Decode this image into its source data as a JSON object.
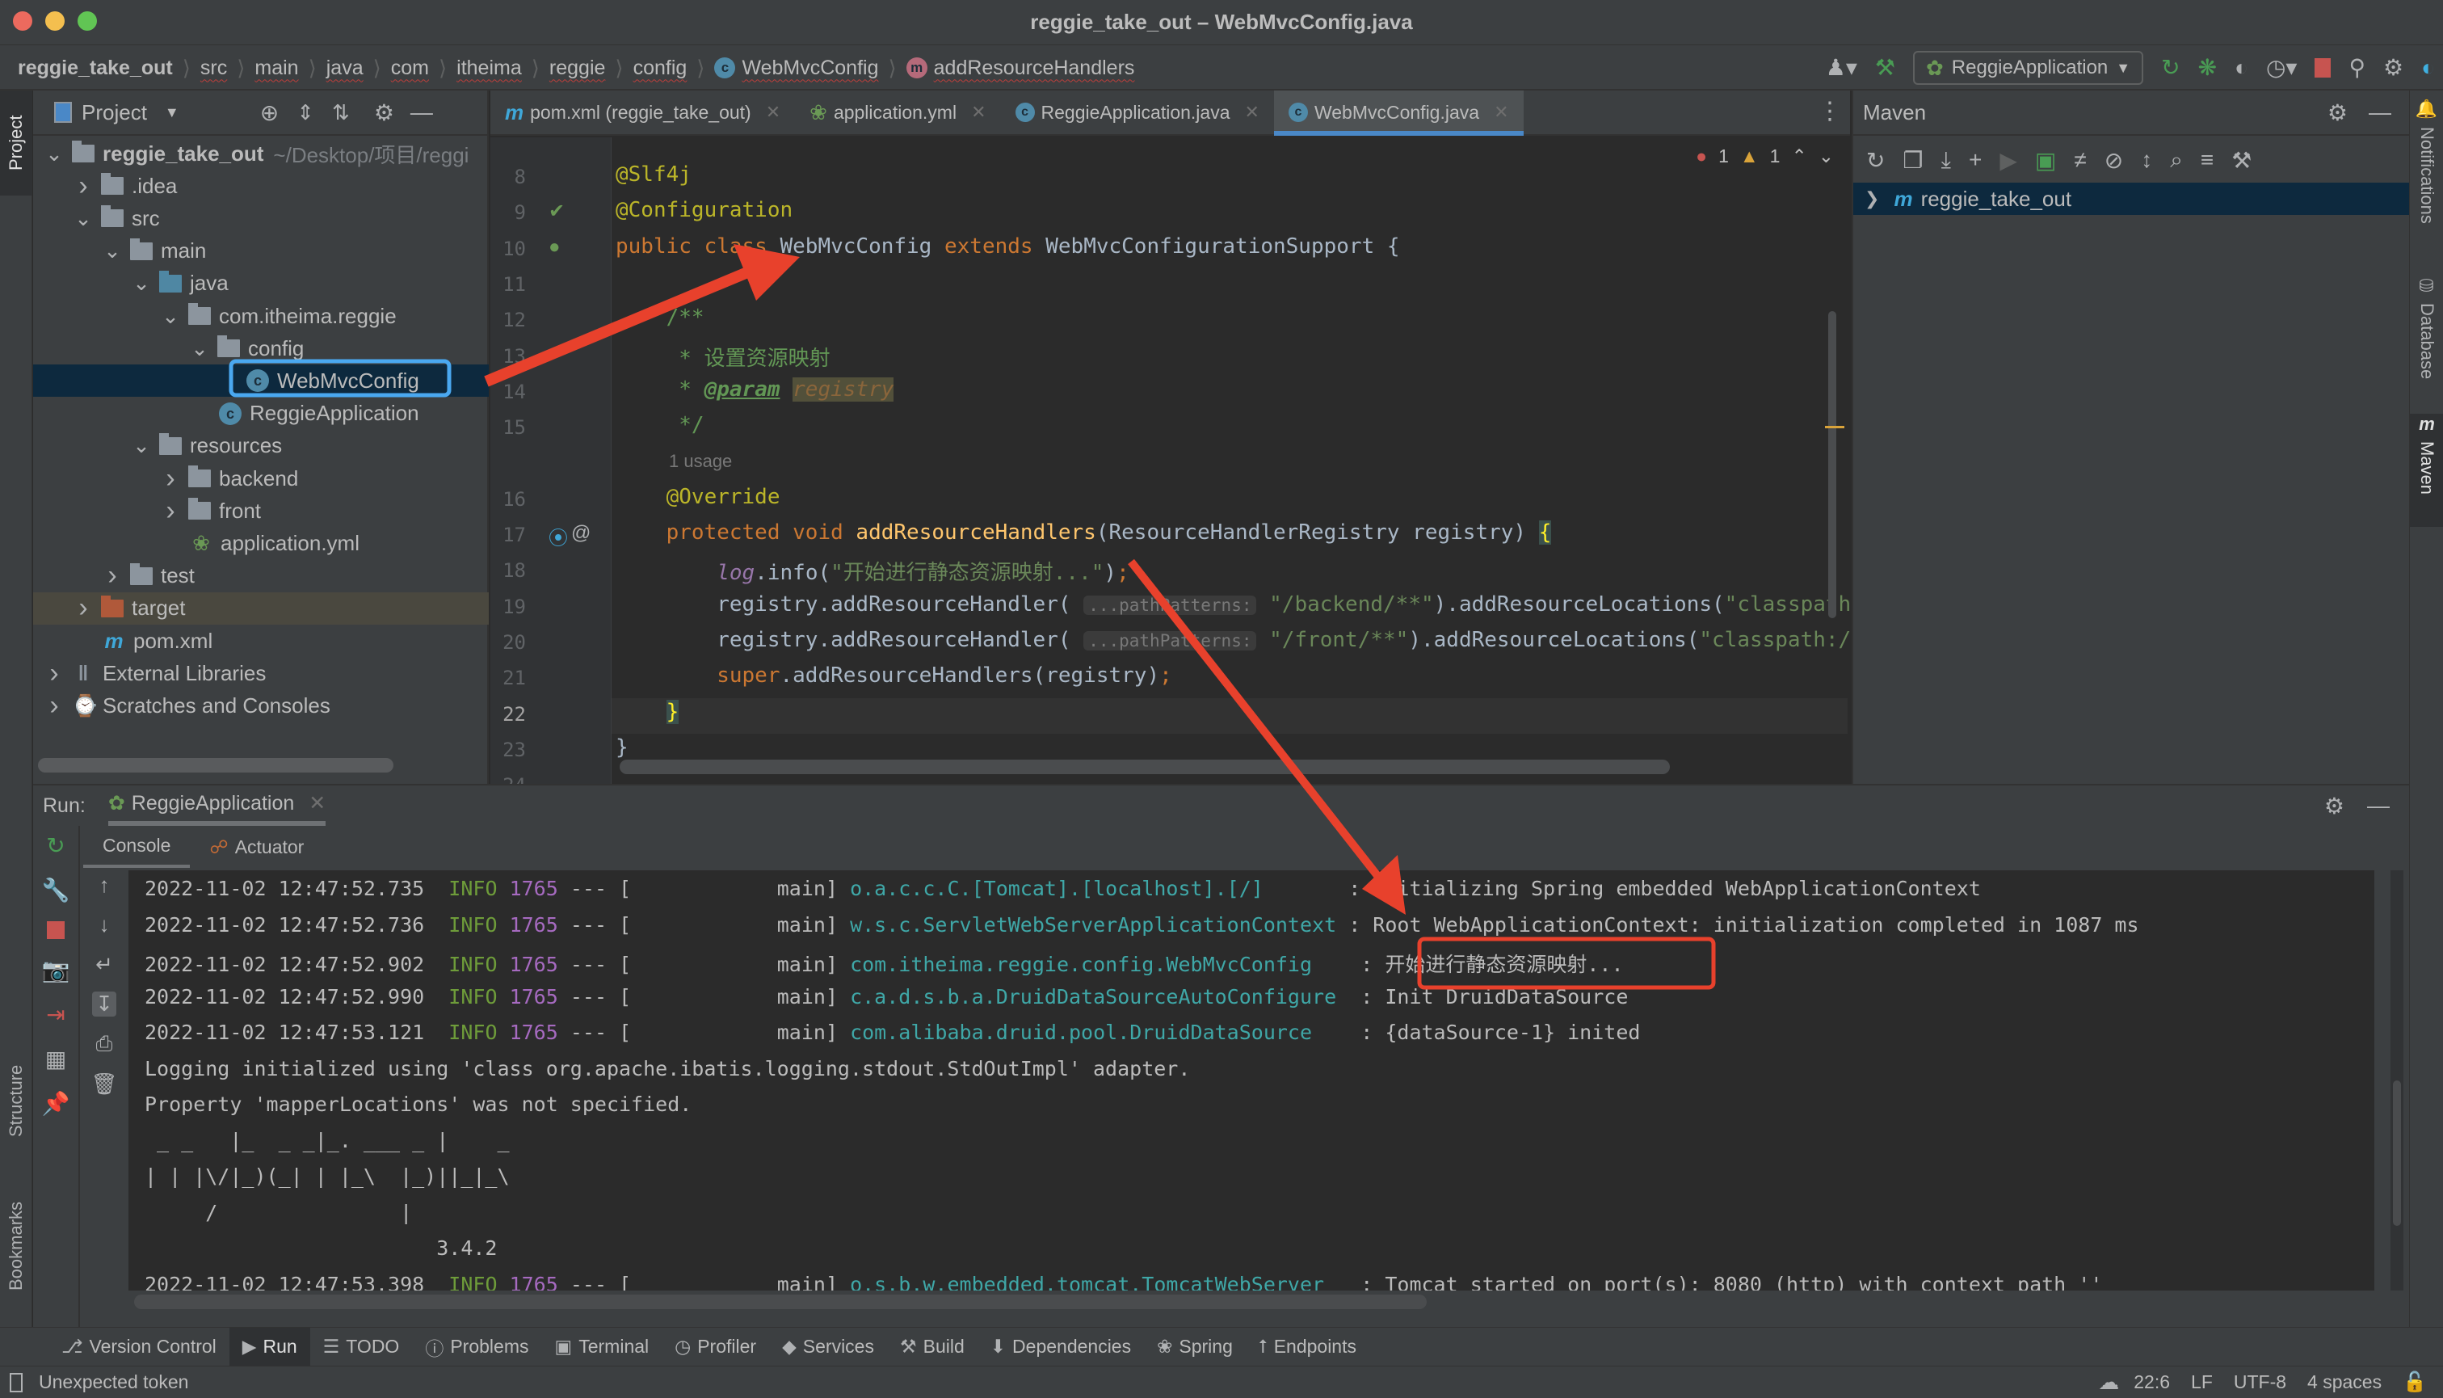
{
  "window": {
    "title": "reggie_take_out – WebMvcConfig.java"
  },
  "breadcrumb": [
    {
      "label": "reggie_take_out"
    },
    {
      "label": "src"
    },
    {
      "label": "main"
    },
    {
      "label": "java"
    },
    {
      "label": "com"
    },
    {
      "label": "itheima"
    },
    {
      "label": "reggie"
    },
    {
      "label": "config"
    },
    {
      "label": "WebMvcConfig",
      "icon": "class-icon"
    },
    {
      "label": "addResourceHandlers",
      "icon": "method-icon"
    }
  ],
  "toolbar": {
    "run_config": "ReggieApplication",
    "icons": [
      "user-icon",
      "build-hammer-icon",
      "rerun-icon",
      "debug-icon",
      "coverage-icon",
      "profile-icon",
      "stop-icon",
      "search-icon",
      "settings-icon",
      "toolbox-icon"
    ]
  },
  "project": {
    "title": "Project",
    "tree": [
      {
        "label": "reggie_take_out",
        "hint": "~/Desktop/项目/reggi",
        "depth": 0,
        "chevron": "down",
        "icon": "module-folder-icon",
        "bold": true
      },
      {
        "label": ".idea",
        "depth": 1,
        "chevron": "right",
        "icon": "folder-icon"
      },
      {
        "label": "src",
        "depth": 1,
        "chevron": "down",
        "icon": "folder-icon"
      },
      {
        "label": "main",
        "depth": 2,
        "chevron": "down",
        "icon": "folder-icon"
      },
      {
        "label": "java",
        "depth": 3,
        "chevron": "down",
        "icon": "source-folder-icon"
      },
      {
        "label": "com.itheima.reggie",
        "depth": 4,
        "chevron": "down",
        "icon": "package-icon"
      },
      {
        "label": "config",
        "depth": 5,
        "chevron": "down",
        "icon": "package-icon"
      },
      {
        "label": "WebMvcConfig",
        "depth": 6,
        "chevron": "",
        "icon": "class-icon",
        "selected": true
      },
      {
        "label": "ReggieApplication",
        "depth": 5.5,
        "chevron": "",
        "icon": "spring-boot-class-icon"
      },
      {
        "label": "resources",
        "depth": 3,
        "chevron": "down",
        "icon": "resources-folder-icon"
      },
      {
        "label": "backend",
        "depth": 4,
        "chevron": "right",
        "icon": "folder-icon"
      },
      {
        "label": "front",
        "depth": 4,
        "chevron": "right",
        "icon": "folder-icon"
      },
      {
        "label": "application.yml",
        "depth": 4.5,
        "chevron": "",
        "icon": "spring-yml-icon"
      },
      {
        "label": "test",
        "depth": 2,
        "chevron": "right",
        "icon": "folder-icon"
      },
      {
        "label": "target",
        "depth": 1,
        "chevron": "right",
        "icon": "excluded-folder-icon",
        "excluded": true
      },
      {
        "label": "pom.xml",
        "depth": 1.5,
        "chevron": "",
        "icon": "maven-icon"
      },
      {
        "label": "External Libraries",
        "depth": 0,
        "chevron": "right",
        "icon": "libraries-icon"
      },
      {
        "label": "Scratches and Consoles",
        "depth": 0,
        "chevron": "right",
        "icon": "scratches-icon"
      }
    ]
  },
  "editor": {
    "tabs": [
      {
        "label": "pom.xml (reggie_take_out)",
        "icon": "maven-icon"
      },
      {
        "label": "application.yml",
        "icon": "spring-yml-icon"
      },
      {
        "label": "ReggieApplication.java",
        "icon": "spring-boot-class-icon"
      },
      {
        "label": "WebMvcConfig.java",
        "icon": "class-icon",
        "active": true
      }
    ],
    "inspections": {
      "errors": "1",
      "warnings": "1"
    },
    "lines": [
      {
        "n": "8",
        "parts": [
          [
            "ann",
            "@Slf4j"
          ]
        ]
      },
      {
        "n": "9",
        "parts": [
          [
            "ann",
            "@Configuration"
          ]
        ]
      },
      {
        "n": "10",
        "parts": [
          [
            "kw",
            "public class "
          ],
          [
            "",
            "WebMvcConfig "
          ],
          [
            "kw",
            "extends "
          ],
          [
            "",
            "WebMvcConfigurationSupport {"
          ]
        ]
      },
      {
        "n": "11",
        "parts": []
      },
      {
        "n": "12",
        "parts": [
          [
            "cm",
            "    /**"
          ]
        ]
      },
      {
        "n": "13",
        "parts": [
          [
            "cm",
            "     * 设置资源映射"
          ]
        ]
      },
      {
        "n": "14",
        "parts": [
          [
            "cm",
            "     * "
          ],
          [
            "cmtag",
            "@param"
          ],
          [
            "cm",
            " "
          ],
          [
            "cmparam",
            "registry"
          ]
        ]
      },
      {
        "n": "15",
        "parts": [
          [
            "cm",
            "     */"
          ]
        ]
      },
      {
        "n": "",
        "usage": "1 usage"
      },
      {
        "n": "16",
        "parts": [
          [
            "ann",
            "    @Override"
          ]
        ]
      },
      {
        "n": "17",
        "parts": [
          [
            "kw",
            "    protected void "
          ],
          [
            "fn",
            "addResourceHandlers"
          ],
          [
            "",
            "(ResourceHandlerRegistry registry) "
          ],
          [
            "brace",
            "{"
          ]
        ]
      },
      {
        "n": "18",
        "parts": [
          [
            "",
            "        "
          ],
          [
            "lg",
            "log"
          ],
          [
            "",
            ".info("
          ],
          [
            "str",
            "\"开始进行静态资源映射...\""
          ],
          [
            "",
            ")"
          ],
          [
            "kw",
            ";"
          ]
        ]
      },
      {
        "n": "19",
        "parts": [
          [
            "",
            "        registry.addResourceHandler( "
          ],
          [
            "hint",
            "...pathPatterns:"
          ],
          [
            "",
            " "
          ],
          [
            "str",
            "\"/backend/**\""
          ],
          [
            "",
            ").addResourceLocations("
          ],
          [
            "str",
            "\"classpath:/backend/\""
          ],
          [
            "",
            ");"
          ]
        ]
      },
      {
        "n": "20",
        "parts": [
          [
            "",
            "        registry.addResourceHandler( "
          ],
          [
            "hint",
            "...pathPatterns:"
          ],
          [
            "",
            " "
          ],
          [
            "str",
            "\"/front/**\""
          ],
          [
            "",
            ").addResourceLocations("
          ],
          [
            "str",
            "\"classpath:/front/\""
          ],
          [
            "",
            ");"
          ]
        ]
      },
      {
        "n": "21",
        "parts": [
          [
            "kw",
            "        super"
          ],
          [
            "",
            ".addResourceHandlers(registry)"
          ],
          [
            "kw",
            ";"
          ]
        ]
      },
      {
        "n": "22",
        "parts": [
          [
            "",
            "    "
          ],
          [
            "brace",
            "}"
          ]
        ],
        "current": true
      },
      {
        "n": "23",
        "parts": [
          [
            "",
            "}"
          ]
        ]
      },
      {
        "n": "24",
        "parts": []
      }
    ]
  },
  "maven": {
    "title": "Maven",
    "tree": [
      {
        "label": "reggie_take_out"
      }
    ],
    "toolbar_icons": [
      "reload-icon",
      "add-maven-project-icon",
      "download-icon",
      "plus-icon",
      "run-maven-icon",
      "execute-goal-icon",
      "toggle-offline-icon",
      "skip-tests-icon",
      "collapse-icon",
      "analyze-dependencies-icon",
      "show-diagram-icon",
      "wrench-icon"
    ]
  },
  "right_stripe": [
    {
      "label": "Notifications",
      "icon": "bell-icon"
    },
    {
      "label": "Database",
      "icon": "database-icon"
    },
    {
      "label": "Maven",
      "icon": "maven-icon",
      "active": true
    }
  ],
  "left_stripe": [
    {
      "label": "Project",
      "active": true
    },
    {
      "label": "Structure"
    },
    {
      "label": "Bookmarks"
    }
  ],
  "run": {
    "label": "Run:",
    "config": "ReggieApplication",
    "tabs": [
      {
        "label": "Console",
        "active": true
      },
      {
        "label": "Actuator",
        "icon": "actuator-icon"
      }
    ],
    "log": [
      {
        "ts": "2022-11-02 12:47:52.735",
        "level": "INFO",
        "pid": "1765",
        "sep": "--- [",
        "thread": "           main]",
        "logger": "o.a.c.c.C.[Tomcat].[localhost].[/]      ",
        "msg": ": Initializing Spring embedded WebApplicationContext"
      },
      {
        "ts": "2022-11-02 12:47:52.736",
        "level": "INFO",
        "pid": "1765",
        "sep": "--- [",
        "thread": "           main]",
        "logger": "w.s.c.ServletWebServerApplicationContext",
        "msg": ": Root WebApplicationContext: initialization completed in 1087 ms"
      },
      {
        "ts": "2022-11-02 12:47:52.902",
        "level": "INFO",
        "pid": "1765",
        "sep": "--- [",
        "thread": "           main]",
        "logger": "com.itheima.reggie.config.WebMvcConfig   ",
        "msg": ": 开始进行静态资源映射...",
        "highlight": true
      },
      {
        "ts": "2022-11-02 12:47:52.990",
        "level": "INFO",
        "pid": "1765",
        "sep": "--- [",
        "thread": "           main]",
        "logger": "c.a.d.s.b.a.DruidDataSourceAutoConfigure ",
        "msg": ": Init DruidDataSource"
      },
      {
        "ts": "2022-11-02 12:47:53.121",
        "level": "INFO",
        "pid": "1765",
        "sep": "--- [",
        "thread": "           main]",
        "logger": "com.alibaba.druid.pool.DruidDataSource   ",
        "msg": ": {dataSource-1} inited"
      },
      {
        "plain": "Logging initialized using 'class org.apache.ibatis.logging.stdout.StdOutImpl' adapter."
      },
      {
        "plain": "Property 'mapperLocations' was not specified."
      },
      {
        "plain": " _ _   |_  _ _|_. ___ _ |    _ "
      },
      {
        "plain": "| | |\\/|_)(_| | |_\\  |_)||_|_\\ "
      },
      {
        "plain": "     /               |         "
      },
      {
        "plain": "                        3.4.2 "
      },
      {
        "ts": "2022-11-02 12:47:53.398",
        "level": "INFO",
        "pid": "1765",
        "sep": "--- [",
        "thread": "           main]",
        "logger": "o.s.b.w.embedded.tomcat.TomcatWebServer  ",
        "msg": ": Tomcat started on port(s): 8080 (http) with context path ''"
      }
    ]
  },
  "tool_windows": [
    {
      "label": "Version Control",
      "icon": "vcs-branch-icon"
    },
    {
      "label": "Run",
      "icon": "run-icon",
      "active": true
    },
    {
      "label": "TODO",
      "icon": "todo-list-icon"
    },
    {
      "label": "Problems",
      "icon": "problems-icon"
    },
    {
      "label": "Terminal",
      "icon": "terminal-icon"
    },
    {
      "label": "Profiler",
      "icon": "profiler-icon"
    },
    {
      "label": "Services",
      "icon": "services-icon"
    },
    {
      "label": "Build",
      "icon": "build-icon"
    },
    {
      "label": "Dependencies",
      "icon": "dependencies-icon"
    },
    {
      "label": "Spring",
      "icon": "spring-icon"
    },
    {
      "label": "Endpoints",
      "icon": "endpoints-icon"
    }
  ],
  "status": {
    "message": "Unexpected token",
    "position": "22:6",
    "line_sep": "LF",
    "encoding": "UTF-8",
    "indent": "4 spaces"
  },
  "colors": {
    "accent": "#4a88c7",
    "annotation_arrow": "#e8412c",
    "selection": "#0d293e",
    "stop": "#c75450",
    "run_green": "#499c54"
  }
}
